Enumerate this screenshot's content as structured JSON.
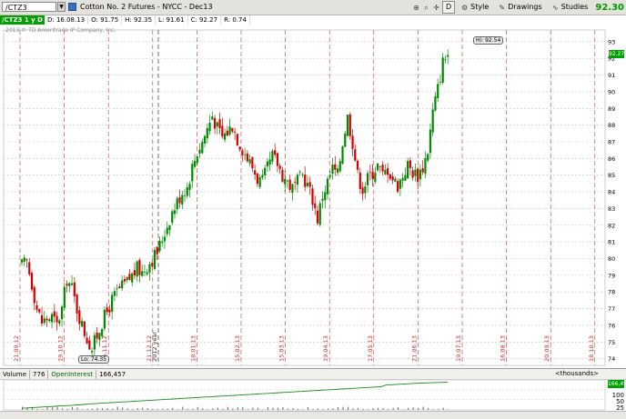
{
  "toolbar": {
    "symbol": "/CTZ3",
    "description": "Cotton No. 2 Futures - NYCC - Dec13",
    "d_label": "D",
    "style_label": "Style",
    "drawings_label": "Drawings",
    "studies_label": "Studies",
    "last_price": "92.30"
  },
  "infobar": {
    "symbol": "/CTZ3 1 y D",
    "date": "D: 16.08.13",
    "open": "O: 91.75",
    "high": "H: 92.35",
    "low": "L: 91.61",
    "close": "C: 92.27",
    "range": "R: 0.74"
  },
  "copyright": "2013 © TD Ameritrade IP Company, Inc.",
  "annotations": {
    "low": "Lo: 74.35",
    "high": "Hi: 92.54",
    "year": "2012 year",
    "price_tag": "92.27"
  },
  "volume_panel": {
    "volume_label": "Volume",
    "volume_value": "776",
    "oi_label": "OpenInterest",
    "oi_value": "166,457",
    "units": "<thousands>",
    "oi_tag": "166,457",
    "axis_labels": [
      "100",
      "50",
      "25"
    ]
  },
  "colors": {
    "up": "#008a00",
    "down": "#d40000",
    "grid_h": "#c8c8c8",
    "grid_v": "#d03030",
    "oi_line": "#1a8a1a"
  },
  "chart_data": {
    "type": "candlestick",
    "y_ticks": [
      74,
      75,
      76,
      77,
      78,
      79,
      80,
      81,
      82,
      83,
      84,
      85,
      86,
      87,
      88,
      89,
      90,
      91,
      92,
      93
    ],
    "ylim": [
      73.6,
      93.7
    ],
    "x_tick_labels": [
      "21.09.12",
      "19.10.12",
      "16.11.12",
      "21.12.12",
      "18.01.13",
      "15.02.13",
      "15.03.13",
      "19.04.13",
      "17.05.13",
      "21.06.13",
      "19.07.13",
      "16.08.13",
      "20.09.13",
      "18.10.13"
    ],
    "close_path": [
      [
        0,
        79.6
      ],
      [
        2,
        79.8
      ],
      [
        4,
        78.5
      ],
      [
        6,
        77.0
      ],
      [
        8,
        76.2
      ],
      [
        10,
        76.4
      ],
      [
        12,
        76.5
      ],
      [
        14,
        76.0
      ],
      [
        16,
        77.0
      ],
      [
        18,
        78.8
      ],
      [
        20,
        78.2
      ],
      [
        22,
        77.0
      ],
      [
        24,
        76.0
      ],
      [
        26,
        75.2
      ],
      [
        28,
        74.6
      ],
      [
        30,
        75.4
      ],
      [
        32,
        76.2
      ],
      [
        34,
        76.8
      ],
      [
        36,
        77.5
      ],
      [
        38,
        78.0
      ],
      [
        40,
        78.3
      ],
      [
        42,
        78.6
      ],
      [
        44,
        79.0
      ],
      [
        46,
        79.4
      ],
      [
        48,
        79.2
      ],
      [
        50,
        79.6
      ],
      [
        52,
        80.0
      ],
      [
        54,
        80.4
      ],
      [
        56,
        81.2
      ],
      [
        58,
        82.0
      ],
      [
        60,
        82.8
      ],
      [
        62,
        83.4
      ],
      [
        64,
        84.0
      ],
      [
        66,
        84.3
      ],
      [
        68,
        85.5
      ],
      [
        70,
        86.4
      ],
      [
        72,
        87.0
      ],
      [
        74,
        87.8
      ],
      [
        76,
        88.6
      ],
      [
        78,
        87.8
      ],
      [
        80,
        87.3
      ],
      [
        82,
        87.6
      ],
      [
        84,
        88.0
      ],
      [
        86,
        87.2
      ],
      [
        88,
        86.6
      ],
      [
        90,
        86.0
      ],
      [
        92,
        85.5
      ],
      [
        94,
        84.8
      ],
      [
        96,
        84.6
      ],
      [
        98,
        85.4
      ],
      [
        100,
        86.1
      ],
      [
        102,
        85.7
      ],
      [
        104,
        85.0
      ],
      [
        106,
        84.6
      ],
      [
        108,
        84.2
      ],
      [
        110,
        84.6
      ],
      [
        112,
        85.0
      ],
      [
        114,
        84.4
      ],
      [
        116,
        83.6
      ],
      [
        118,
        82.4
      ],
      [
        120,
        83.8
      ],
      [
        122,
        84.6
      ],
      [
        124,
        85.4
      ],
      [
        126,
        85.0
      ],
      [
        128,
        87.0
      ],
      [
        130,
        88.5
      ],
      [
        132,
        87.0
      ],
      [
        134,
        85.0
      ],
      [
        136,
        84.2
      ],
      [
        138,
        84.8
      ],
      [
        140,
        85.2
      ],
      [
        142,
        85.6
      ],
      [
        144,
        85.0
      ],
      [
        146,
        85.4
      ],
      [
        148,
        84.8
      ],
      [
        150,
        84.4
      ],
      [
        152,
        85.0
      ],
      [
        154,
        85.6
      ],
      [
        156,
        85.2
      ],
      [
        158,
        85.0
      ],
      [
        160,
        85.5
      ],
      [
        162,
        86.5
      ],
      [
        164,
        88.8
      ],
      [
        166,
        90.2
      ],
      [
        168,
        91.8
      ],
      [
        170,
        92.27
      ]
    ],
    "high_label": 92.54,
    "low_label": 74.35,
    "open_interest_series": [
      10,
      12,
      14,
      16,
      18,
      20,
      22,
      24,
      26,
      28,
      30,
      33,
      36,
      38,
      40,
      42,
      44,
      46,
      48,
      50,
      52,
      54,
      56,
      58,
      60,
      62,
      64,
      66,
      68,
      70,
      72,
      74,
      76,
      78,
      80,
      82,
      84,
      86,
      88,
      90,
      92,
      94,
      96,
      98,
      100,
      102,
      104,
      106,
      108,
      110,
      112,
      114,
      116,
      118,
      120,
      122,
      124,
      126,
      128,
      130,
      132,
      134,
      136,
      138,
      140,
      150,
      152,
      154,
      156,
      158,
      160,
      162,
      163,
      164,
      165,
      166,
      166.5
    ]
  }
}
